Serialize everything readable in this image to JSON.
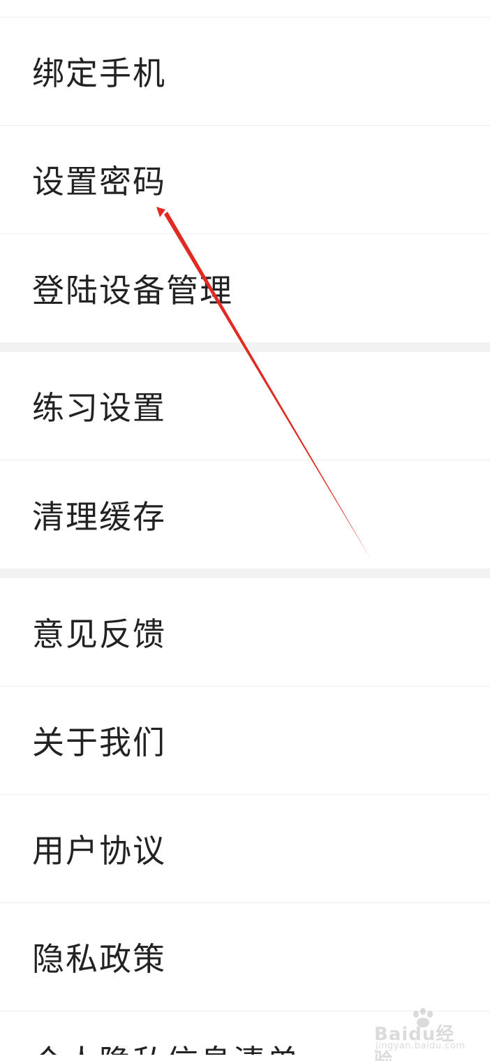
{
  "settings": {
    "group_account": [
      {
        "label": "绑定手机"
      },
      {
        "label": "设置密码"
      },
      {
        "label": "登陆设备管理"
      }
    ],
    "group_practice": [
      {
        "label": "练习设置"
      },
      {
        "label": "清理缓存"
      }
    ],
    "group_about": [
      {
        "label": "意见反馈"
      },
      {
        "label": "关于我们"
      },
      {
        "label": "用户协议"
      },
      {
        "label": "隐私政策"
      },
      {
        "label": "个人隐私信息清单"
      }
    ]
  },
  "annotation": {
    "arrow_color": "#e02a22"
  },
  "watermark": {
    "brand": "Baidu经验",
    "url": "jingyan.baidu.com"
  },
  "colors": {
    "text": "#222222",
    "divider": "#eeeeee",
    "group_gap": "#f2f2f2"
  }
}
